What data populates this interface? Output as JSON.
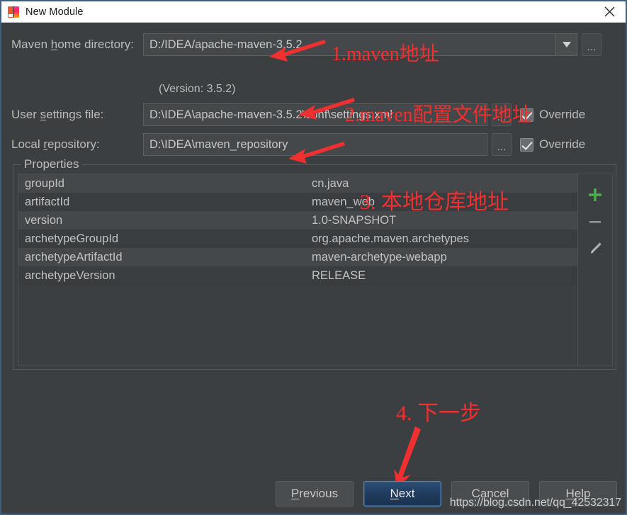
{
  "window": {
    "title": "New Module",
    "app_icon": "intellij-idea-icon",
    "close_icon": "close-icon"
  },
  "form": {
    "maven_home": {
      "label_prefix": "Maven ",
      "label_mnemonic": "h",
      "label_suffix": "ome directory:",
      "value": "D:/IDEA/apache-maven-3.5.2",
      "dropdown_icon": "chevron-down-icon",
      "browse_label": "...",
      "version_note": "(Version: 3.5.2)"
    },
    "user_settings": {
      "label_prefix": "User ",
      "label_mnemonic": "s",
      "label_suffix": "ettings file:",
      "value": "D:\\IDEA\\apache-maven-3.5.2\\conf\\settings.xml",
      "browse_label": "...",
      "override_label": "Override",
      "override_checked": true
    },
    "local_repository": {
      "label_prefix": "Local ",
      "label_mnemonic": "r",
      "label_suffix": "epository:",
      "value": "D:\\IDEA\\maven_repository",
      "browse_label": "...",
      "override_label": "Override",
      "override_checked": true
    }
  },
  "properties": {
    "legend": "Properties",
    "rows": [
      {
        "key": "groupId",
        "value": "cn.java"
      },
      {
        "key": "artifactId",
        "value": "maven_web"
      },
      {
        "key": "version",
        "value": "1.0-SNAPSHOT"
      },
      {
        "key": "archetypeGroupId",
        "value": "org.apache.maven.archetypes"
      },
      {
        "key": "archetypeArtifactId",
        "value": "maven-archetype-webapp"
      },
      {
        "key": "archetypeVersion",
        "value": "RELEASE"
      }
    ],
    "toolbar": {
      "add_icon": "plus-icon",
      "remove_icon": "minus-icon",
      "edit_icon": "pencil-icon",
      "add_color": "#4caf50",
      "remove_color": "#9a9d9f",
      "edit_color": "#b9bcbe"
    }
  },
  "buttons": {
    "previous": {
      "prefix": "",
      "mnemonic": "P",
      "suffix": "revious"
    },
    "next": {
      "prefix": "",
      "mnemonic": "N",
      "suffix": "ext"
    },
    "cancel": {
      "prefix": "C",
      "mnemonic": "",
      "suffix": "ancel"
    },
    "help": {
      "prefix": "",
      "mnemonic": "H",
      "suffix": "elp"
    }
  },
  "annotations": {
    "a1": "1.maven地址",
    "a2": "2.maven配置文件地址",
    "a3": "3. 本地仓库地址",
    "a4": "4. 下一步",
    "color": "#f03030"
  },
  "watermark": "https://blog.csdn.net/qq_42532317"
}
